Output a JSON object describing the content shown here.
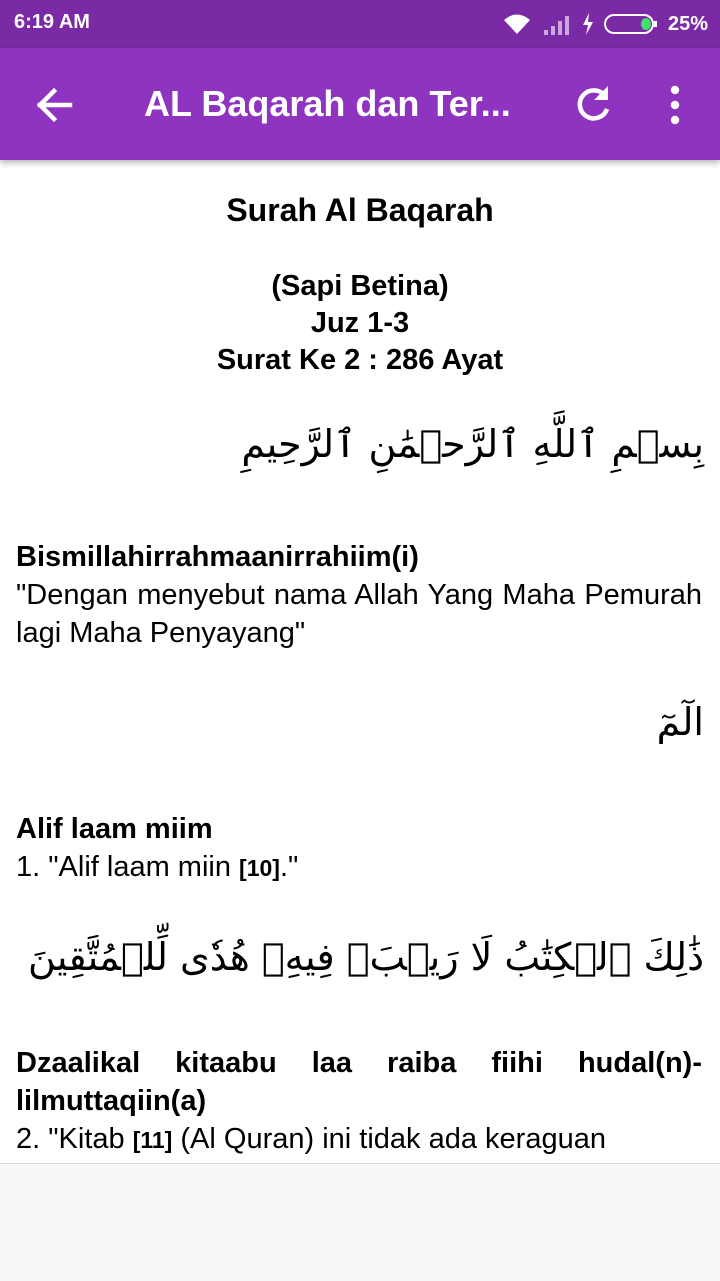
{
  "status_bar": {
    "time": "6:19 AM",
    "battery_percent": "25%",
    "icons": [
      "wifi-icon",
      "signal-icon",
      "charging-icon",
      "battery-icon"
    ]
  },
  "app_bar": {
    "title": "AL Baqarah dan Ter...",
    "color": "#8e34c0",
    "icons": [
      "back-arrow-icon",
      "refresh-icon",
      "more-vert-icon"
    ]
  },
  "header": {
    "title": "Surah Al Baqarah",
    "subtitle": "(Sapi Betina)",
    "juz": "Juz 1-3",
    "surat_info": "Surat Ke 2 : 286 Ayat"
  },
  "verses": [
    {
      "arabic": "بِسۡمِ ٱللَّهِ ٱلرَّحۡمَٰنِ ٱلرَّحِيمِ",
      "latin": "Bismillahirrahmaanirrahiim(i)",
      "translation": "\"Dengan menyebut nama Allah Yang Maha Pemurah lagi Maha Penyayang\""
    },
    {
      "arabic": "الٓمٓ",
      "latin": "Alif laam miim",
      "translation_prefix": "1. \"Alif laam miin ",
      "footnote": "[10]",
      "translation_suffix": ".\""
    },
    {
      "arabic": "ذَٰلِكَ ٱلۡكِتَٰبُ لَا رَيۡبَۛ فِيهِۛ هُدٗى لِّلۡمُتَّقِينَ",
      "latin": "Dzaalikal kitaabu laa raiba fiihi hudal(n)-lilmuttaqiin(a)",
      "translation_prefix": "2. \"Kitab ",
      "footnote": "[11]",
      "translation_suffix": " (Al Quran) ini tidak ada keraguan"
    }
  ]
}
